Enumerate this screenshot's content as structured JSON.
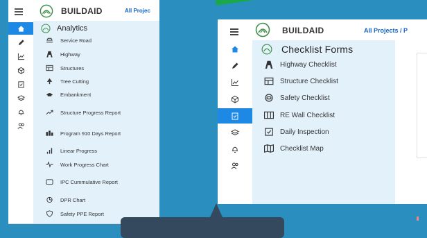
{
  "left": {
    "brand": "BUILDAID",
    "project": "All Projec",
    "menu_title": "Analytics",
    "rail_icons": [
      "home-icon",
      "pencil-icon",
      "chart-icon",
      "cube-icon",
      "clipboard-icon",
      "layers-icon",
      "bell-icon",
      "users-icon"
    ],
    "items": [
      {
        "label": "Service Road",
        "icon": "road-icon"
      },
      {
        "label": "Highway",
        "icon": "highway-icon"
      },
      {
        "label": "Structures",
        "icon": "structure-icon"
      },
      {
        "label": "Tree Cutting",
        "icon": "tree-icon"
      },
      {
        "label": "Embankment",
        "icon": "embankment-icon"
      },
      {
        "label": "Structure Progress Report",
        "icon": "trend-icon"
      },
      {
        "label": "Program 910 Days Report",
        "icon": "program-icon"
      },
      {
        "label": "Linear Progress",
        "icon": "bars-icon"
      },
      {
        "label": "Work Progress Chart",
        "icon": "pulse-icon"
      },
      {
        "label": "IPC Cummulative Report",
        "icon": "ipc-icon"
      },
      {
        "label": "DPR Chart",
        "icon": "dpr-icon"
      },
      {
        "label": "Safety PPE Report",
        "icon": "shield-icon"
      }
    ]
  },
  "right": {
    "brand": "BUILDAID",
    "project": "All Projects / P",
    "menu_title": "Checklist Forms",
    "rail_icons": [
      "home-icon",
      "pencil-icon",
      "chart-icon",
      "cube-icon",
      "clipboard-icon",
      "layers-icon",
      "bell-icon",
      "users-icon"
    ],
    "items": [
      {
        "label": "Highway Checklist",
        "icon": "highway-icon"
      },
      {
        "label": "Structure Checklist",
        "icon": "structure-icon"
      },
      {
        "label": "Safety Checklist",
        "icon": "safety-icon"
      },
      {
        "label": "RE Wall Checklist",
        "icon": "wall-icon"
      },
      {
        "label": "Daily Inspection",
        "icon": "clipboard-check-icon"
      },
      {
        "label": "Checklist Map",
        "icon": "map-icon"
      }
    ]
  },
  "colors": {
    "background": "#2a8fbf",
    "accent": "#1e88e5",
    "menu_bg": "#e3f1fb",
    "project_link": "#1565c0",
    "tooltip": "#34495e",
    "green": "#1aa84a"
  }
}
